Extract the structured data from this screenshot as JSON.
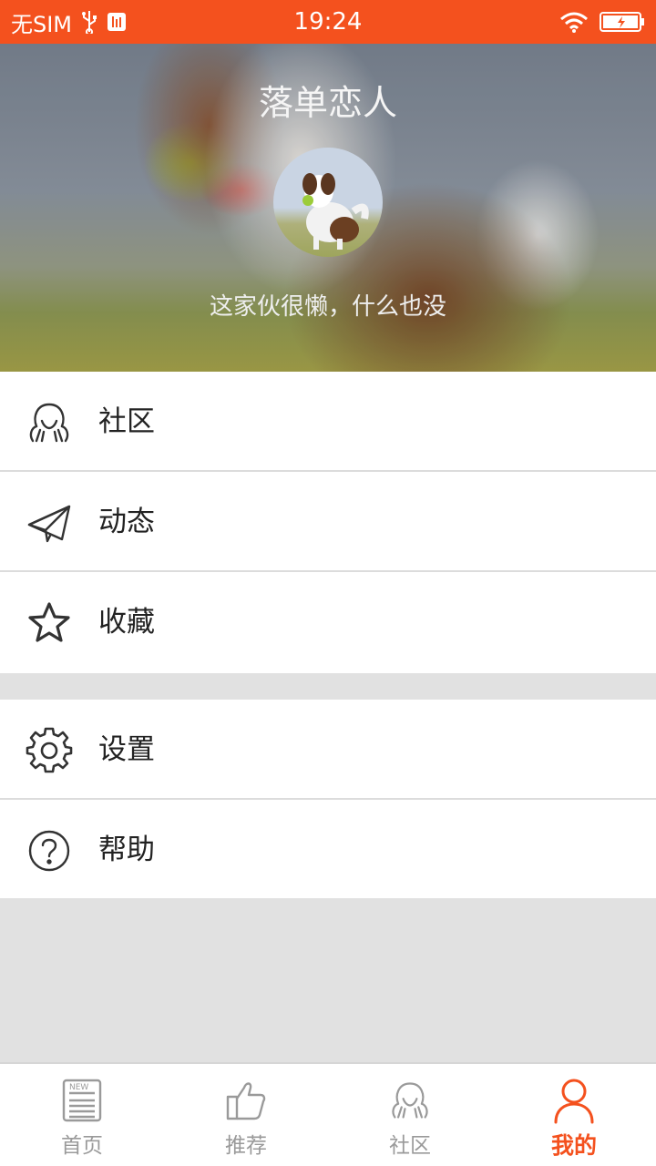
{
  "status_bar": {
    "carrier": "无SIM",
    "time": "19:24"
  },
  "profile": {
    "name": "落单恋人",
    "bio": "这家伙很懒，什么也没"
  },
  "menu": [
    {
      "label": "社区",
      "icon": "community-icon"
    },
    {
      "label": "动态",
      "icon": "paper-plane-icon"
    },
    {
      "label": "收藏",
      "icon": "star-icon"
    },
    {
      "label": "设置",
      "icon": "gear-icon"
    },
    {
      "label": "帮助",
      "icon": "help-icon"
    }
  ],
  "tabs": [
    {
      "label": "首页",
      "icon": "news-icon",
      "active": false
    },
    {
      "label": "推荐",
      "icon": "thumbs-up-icon",
      "active": false
    },
    {
      "label": "社区",
      "icon": "community-icon",
      "active": false
    },
    {
      "label": "我的",
      "icon": "person-icon",
      "active": true
    }
  ],
  "colors": {
    "accent": "#f4511e",
    "background": "#e1e1e1",
    "text": "#222222",
    "tab_inactive": "#9a9a9a"
  }
}
